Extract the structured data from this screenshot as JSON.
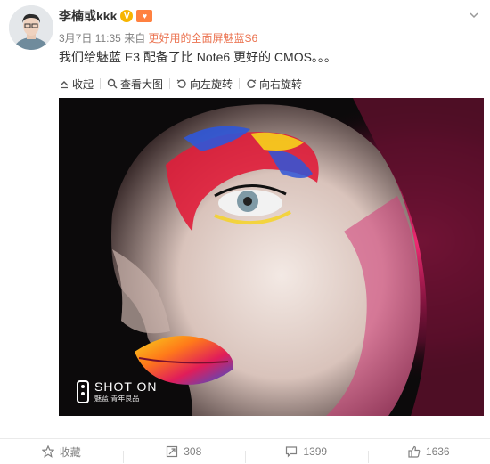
{
  "user": {
    "name": "李楠或kkk",
    "verified_badge": "V",
    "level_badge": "♥"
  },
  "post": {
    "date": "3月7日",
    "time": "11:35",
    "source_prefix": "来自",
    "device": "更好用的全面屏魅蓝S6",
    "text": "我们给魅蓝 E3 配备了比 Note6 更好的 CMOS。。。"
  },
  "toolbar": {
    "collapse": "收起",
    "view_large": "查看大图",
    "rotate_left": "向左旋转",
    "rotate_right": "向右旋转"
  },
  "photo": {
    "watermark_title": "SHOT ON",
    "watermark_brand": "魅蓝",
    "watermark_slogan": "青年良品"
  },
  "actions": {
    "favorite": "收藏",
    "repost": "308",
    "comment": "1399",
    "like": "1636"
  },
  "colors": {
    "device_link": "#eb7350",
    "verified": "#f7b500",
    "level": "#ff8140"
  }
}
